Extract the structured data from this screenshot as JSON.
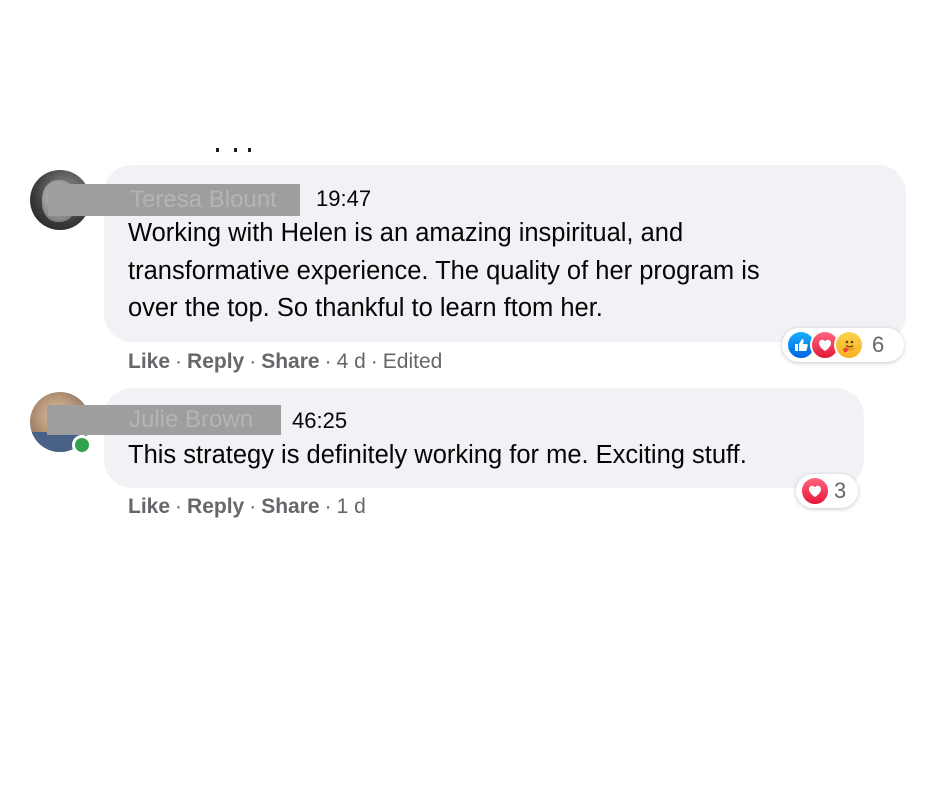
{
  "comments": [
    {
      "author": "Teresa Blount",
      "timestamp": "19:47",
      "text_lines": [
        "Working with Helen is an amazing inspiritual, and",
        "transformative experience. The quality of her program is",
        "over the top. So thankful to learn ftom her."
      ],
      "actions": {
        "like": "Like",
        "reply": "Reply",
        "share": "Share",
        "age": "4 d",
        "edited": "Edited"
      },
      "reactions": {
        "icons": [
          "like-icon",
          "love-icon",
          "care-icon"
        ],
        "count": "6"
      }
    },
    {
      "author": "Julie Brown",
      "timestamp": "46:25",
      "online": true,
      "text_lines": [
        "This strategy is definitely working for me. Exciting stuff."
      ],
      "actions": {
        "like": "Like",
        "reply": "Reply",
        "share": "Share",
        "age": "1 d"
      },
      "reactions": {
        "icons": [
          "love-icon"
        ],
        "count": "3"
      }
    }
  ],
  "separator": "·",
  "colors": {
    "bubble": "#f0f2f5",
    "action_text": "#65676b",
    "online": "#31a24c",
    "redaction": "#9e9e9e"
  }
}
